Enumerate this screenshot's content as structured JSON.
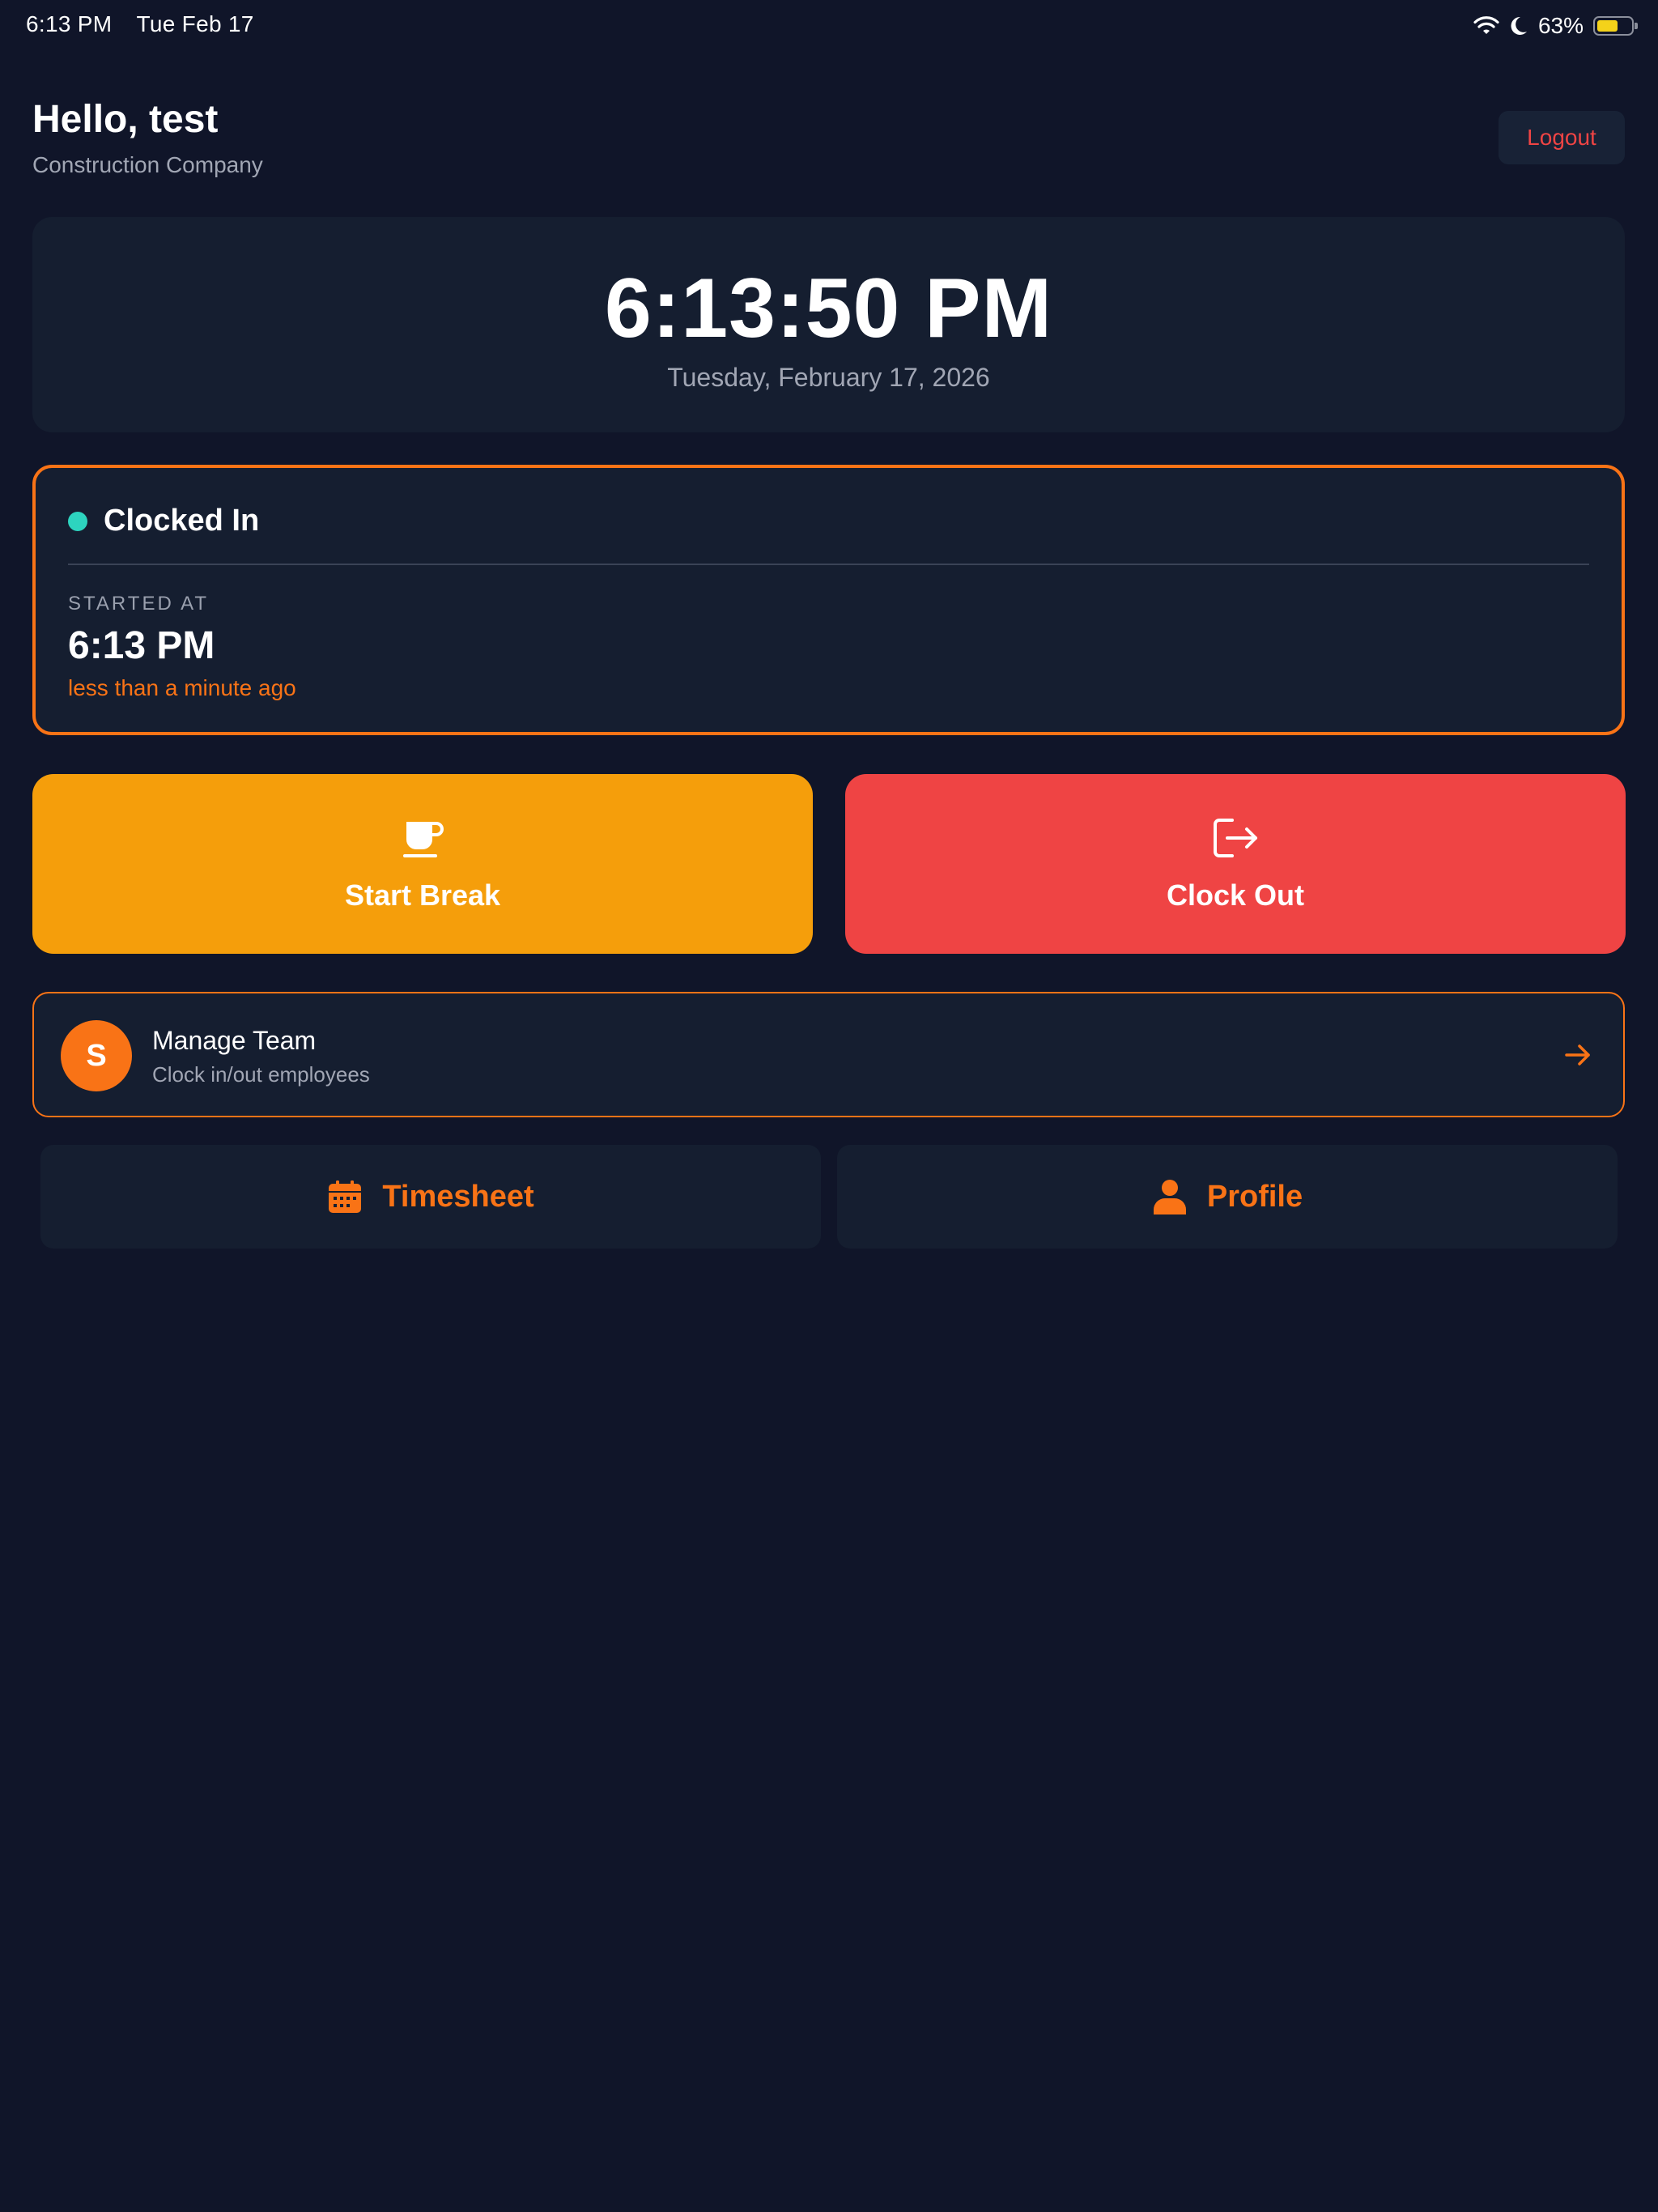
{
  "status_bar": {
    "time": "6:13 PM",
    "date": "Tue Feb 17",
    "battery": "63%",
    "battery_level": 0.63,
    "icons": [
      "wifi-icon",
      "moon-icon",
      "battery-icon"
    ]
  },
  "header": {
    "greeting": "Hello, test",
    "company": "Construction Company",
    "logout_label": "Logout"
  },
  "clock": {
    "time": "6:13:50 PM",
    "date": "Tuesday, February 17, 2026"
  },
  "status": {
    "label": "Clocked In",
    "started_label": "STARTED AT",
    "started_time": "6:13 PM",
    "elapsed": "less than a minute ago"
  },
  "actions": {
    "start_break": "Start Break",
    "clock_out": "Clock Out"
  },
  "team": {
    "avatar_letter": "S",
    "title": "Manage Team",
    "subtitle": "Clock in/out employees"
  },
  "nav": {
    "timesheet": "Timesheet",
    "profile": "Profile"
  },
  "colors": {
    "background": "#101529",
    "card": "#151e30",
    "accent": "#f97316",
    "break": "#f59e0b",
    "danger": "#ef4444",
    "clocked_in": "#2dd4bf"
  }
}
